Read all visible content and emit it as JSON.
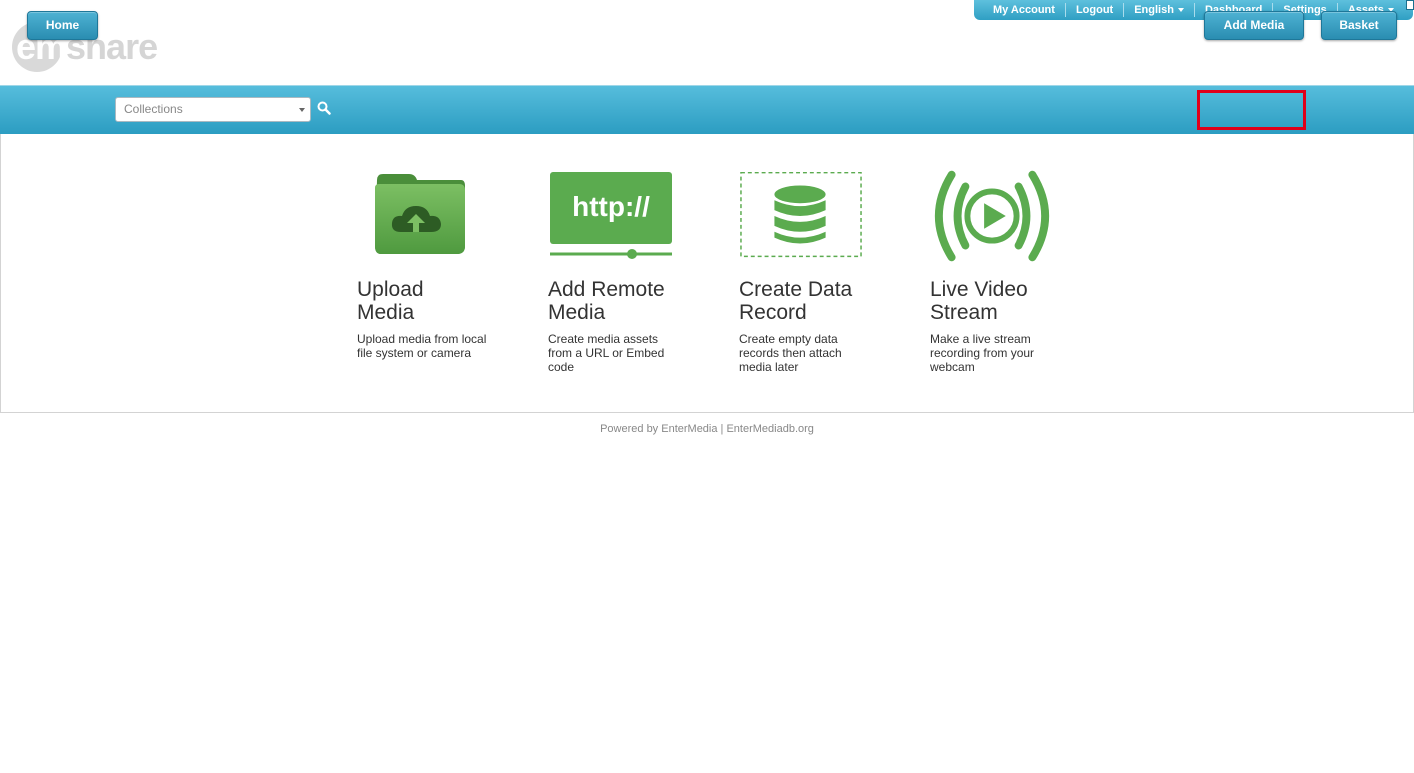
{
  "topnav": {
    "my_account": "My Account",
    "logout": "Logout",
    "language": "English",
    "dashboard": "Dashboard",
    "settings": "Settings",
    "assets": "Assets"
  },
  "logo": {
    "text_em": "em",
    "text_share": "share"
  },
  "mainbar": {
    "home": "Home",
    "collections_placeholder": "Collections",
    "add_media": "Add Media",
    "basket": "Basket"
  },
  "cards": [
    {
      "title_line1": "Upload",
      "title_line2": "Media",
      "description": "Upload media from local file system or camera",
      "icon": "upload-folder-icon"
    },
    {
      "title_line1": "Add Remote",
      "title_line2": "Media",
      "description": "Create media assets from a URL or Embed code",
      "icon": "http-icon",
      "icon_text": "http://"
    },
    {
      "title_line1": "Create Data",
      "title_line2": "Record",
      "description": "Create empty data records then attach media later",
      "icon": "database-icon"
    },
    {
      "title_line1": "Live Video",
      "title_line2": "Stream",
      "description": "Make a live stream recording from your webcam",
      "icon": "live-stream-icon"
    }
  ],
  "footer": "Powered by EnterMedia | EnterMediadb.org",
  "colors": {
    "accent": "#3aabd0",
    "icon_green": "#5bab4f",
    "highlight": "#e0001a"
  }
}
